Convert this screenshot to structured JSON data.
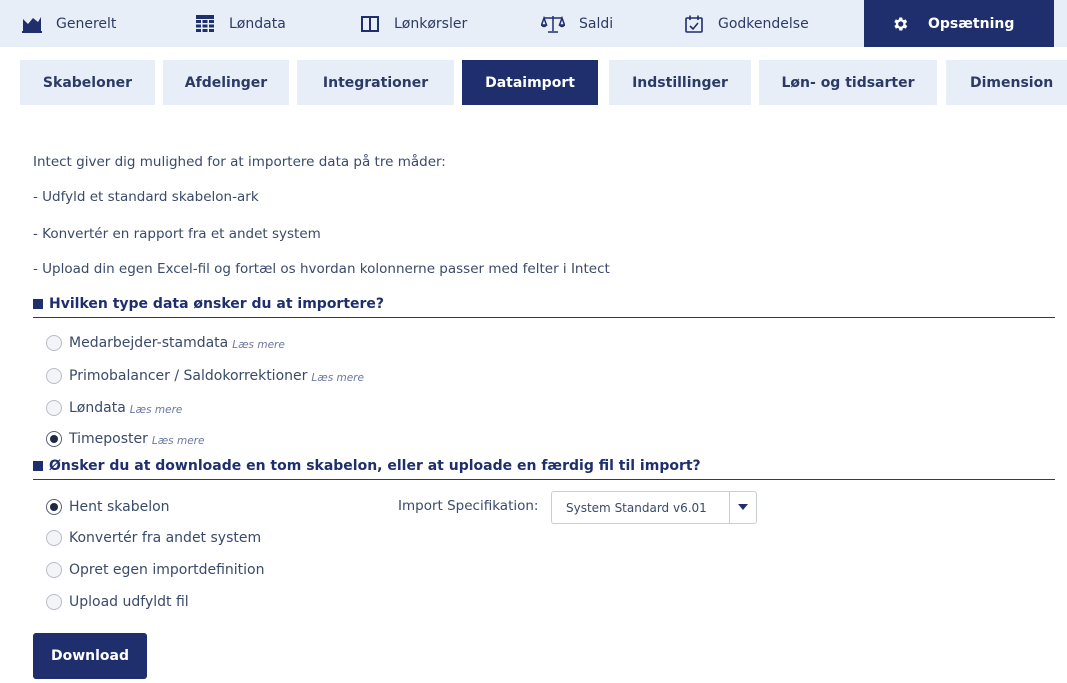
{
  "topnav": {
    "items": [
      {
        "label": "Generelt",
        "icon": "chart-icon"
      },
      {
        "label": "Løndata",
        "icon": "grid-icon"
      },
      {
        "label": "Lønkørsler",
        "icon": "columns-icon"
      },
      {
        "label": "Saldi",
        "icon": "scale-icon"
      },
      {
        "label": "Godkendelse",
        "icon": "calendar-check-icon"
      },
      {
        "label": "Opsætning",
        "icon": "gear-icon",
        "active": true
      }
    ]
  },
  "subnav": {
    "tabs": [
      {
        "label": "Skabeloner"
      },
      {
        "label": "Afdelinger"
      },
      {
        "label": "Integrationer"
      },
      {
        "label": "Dataimport",
        "active": true
      },
      {
        "label": "Indstillinger"
      },
      {
        "label": "Løn- og tidsarter"
      },
      {
        "label": "Dimension"
      }
    ]
  },
  "intro": {
    "line1": "Intect giver dig mulighed for at importere data på tre måder:",
    "line2": "- Udfyld et standard skabelon-ark",
    "line3": "- Konvertér en rapport fra et andet system",
    "line4": "- Upload din egen Excel-fil og fortæl os hvordan kolonnerne passer med felter i Intect"
  },
  "section1": {
    "heading": "Hvilken type data ønsker du at importere?",
    "options": [
      {
        "label": "Medarbejder-stamdata",
        "more": "Læs mere",
        "checked": false
      },
      {
        "label": "Primobalancer / Saldokorrektioner",
        "more": "Læs mere",
        "checked": false
      },
      {
        "label": "Løndata",
        "more": "Læs mere",
        "checked": false
      },
      {
        "label": "Timeposter",
        "more": "Læs mere",
        "checked": true
      }
    ]
  },
  "section2": {
    "heading": "Ønsker du at downloade en tom skabelon, eller at uploade en færdig fil til import?",
    "options": [
      {
        "label": "Hent skabelon",
        "checked": true
      },
      {
        "label": "Konvertér fra andet system",
        "checked": false
      },
      {
        "label": "Opret egen importdefinition",
        "checked": false
      },
      {
        "label": "Upload udfyldt fil",
        "checked": false
      }
    ],
    "spec_label": "Import Specifikation:",
    "spec_value": "System Standard v6.01"
  },
  "download_label": "Download",
  "colors": {
    "primary": "#1f2f6e",
    "nav_bg": "#e8eef7",
    "text": "#3a4a6a"
  }
}
